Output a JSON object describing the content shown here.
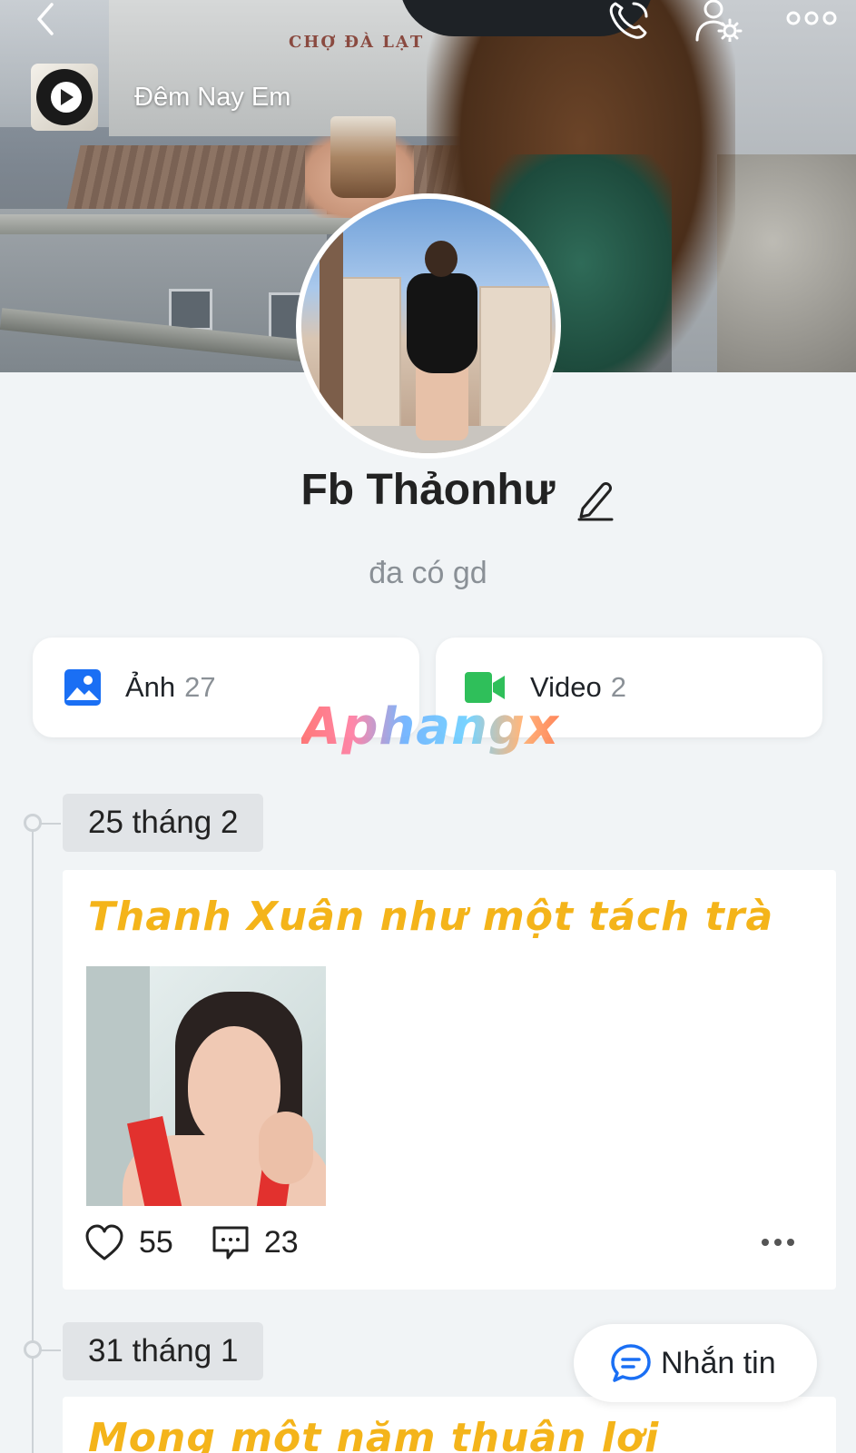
{
  "header": {
    "back_icon": "chevron-left-icon",
    "call_icon": "phone-icon",
    "settings_icon": "user-settings-icon",
    "more_icon": "more-horizontal-icon"
  },
  "cover": {
    "sign_text": "CHỢ ĐÀ LẠT"
  },
  "music": {
    "title": "Đêm Nay Em"
  },
  "profile": {
    "name": "Fb Thảonhư",
    "bio": "đa có gd"
  },
  "media": {
    "photos_label": "Ảnh",
    "photos_count": "27",
    "videos_label": "Video",
    "videos_count": "2"
  },
  "watermark": "Aphangx",
  "timeline": [
    {
      "date": "25 tháng 2",
      "text": "Thanh Xuân như một tách trà",
      "likes": "55",
      "comments": "23"
    },
    {
      "date": "31 tháng 1",
      "text": "Mong một năm thuận lợi"
    }
  ],
  "message_button": {
    "label": "Nhắn tin"
  },
  "colors": {
    "accent_blue": "#1a6ff4",
    "video_green": "#2fbf5a",
    "post_text": "#f4b41a",
    "background": "#f1f4f6"
  }
}
